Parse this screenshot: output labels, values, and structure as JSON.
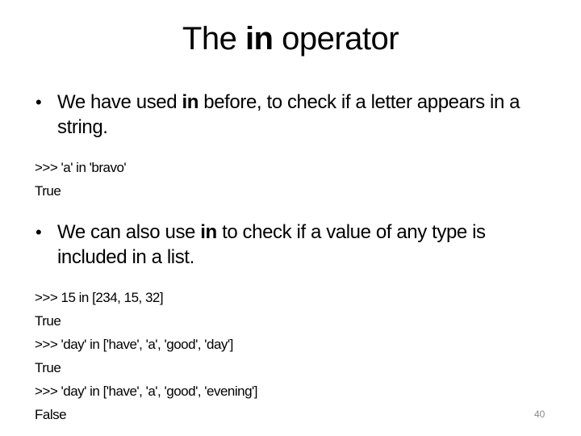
{
  "slide": {
    "title": {
      "prefix": "The ",
      "keyword": "in",
      "suffix": " operator"
    },
    "bullets": [
      {
        "symbol": "•",
        "before": "We have used ",
        "keyword": "in",
        "after": " before, to check if a letter appears in a string."
      },
      {
        "symbol": "•",
        "before": "We can also use ",
        "keyword": "in",
        "after": " to check if a value of any type is included in a list."
      }
    ],
    "code_blocks": [
      {
        "lines": [
          ">>> 'a' in 'bravo'",
          "True"
        ]
      },
      {
        "lines": [
          ">>> 15 in [234, 15, 32]",
          "True",
          ">>> 'day' in ['have', 'a', 'good', 'day']",
          "True",
          ">>> 'day' in ['have', 'a', 'good', 'evening']",
          "False"
        ]
      }
    ],
    "page_number": "40"
  }
}
